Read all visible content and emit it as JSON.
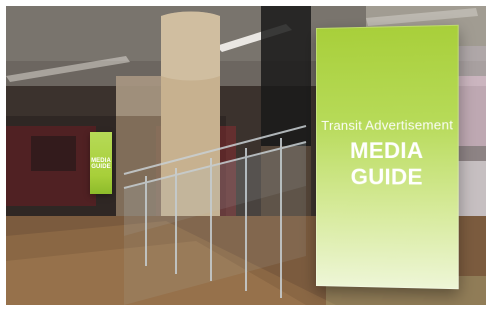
{
  "billboard": {
    "subtitle": "Transit Advertisement",
    "title": "MEDIA GUIDE"
  },
  "mini_billboard": {
    "title": "MEDIA GUIDE"
  },
  "colors": {
    "billboard_green": "#a8cf3a",
    "text": "#ffffff"
  },
  "icons": {
    "scene": "subway-concourse-photo"
  }
}
